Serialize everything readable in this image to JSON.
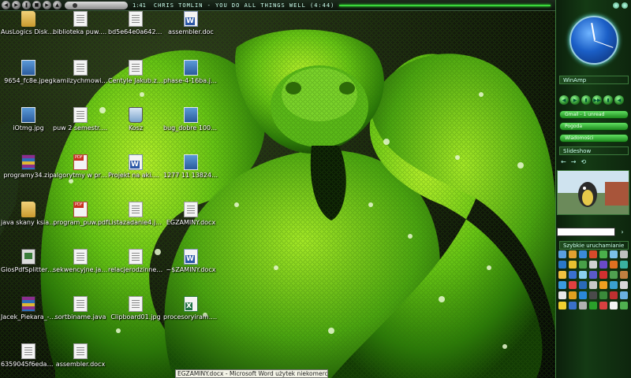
{
  "media_bar": {
    "time": "1:41",
    "track": "CHRIS TOMLIN - YOU DO ALL THINGS WELL (4:44)",
    "buttons": [
      "prev-icon",
      "play-icon",
      "pause-icon",
      "stop-icon",
      "next-icon",
      "eject-icon"
    ]
  },
  "desktop_icons": [
    {
      "label": "AusLogics Disk Defrag",
      "type": "folder"
    },
    {
      "label": "biblioteka puw.txt",
      "type": "doc"
    },
    {
      "label": "bd5e64e0a642b6a9....",
      "type": "doc"
    },
    {
      "label": "assembler.doc",
      "type": "word"
    },
    {
      "label": "9654_fc8e.jpeg",
      "type": "img"
    },
    {
      "label": "kamilzychmowi.txt",
      "type": "doc"
    },
    {
      "label": "Centyle Jakub.zone",
      "type": "doc"
    },
    {
      "label": "phase-4-16ba.jpg",
      "type": "img"
    },
    {
      "label": "iOtmg.jpg",
      "type": "img"
    },
    {
      "label": "puw 2 semestr.txt",
      "type": "doc"
    },
    {
      "label": "Kosz",
      "type": "bin"
    },
    {
      "label": "bug_dobre 100%.jpg",
      "type": "img"
    },
    {
      "label": "programy34.zip",
      "type": "rar"
    },
    {
      "label": "algorytmy w przykładach Delphi...",
      "type": "pdf"
    },
    {
      "label": "Projekt na aki.doc",
      "type": "word"
    },
    {
      "label": "1277 11 1382424...",
      "type": "img"
    },
    {
      "label": "java skany ksiazek",
      "type": "folder"
    },
    {
      "label": "program_puw.pdf",
      "type": "pdf"
    },
    {
      "label": "Listazadanie4.java",
      "type": "doc"
    },
    {
      "label": "EGZAMINY.docx",
      "type": "doc"
    },
    {
      "label": "GiosPdfSplitterMer...",
      "type": "app"
    },
    {
      "label": "sekwencyjne.java",
      "type": "doc"
    },
    {
      "label": "relacjerodzinne.java",
      "type": "doc"
    },
    {
      "label": "~$ZAMINY.docx",
      "type": "word"
    },
    {
      "label": "Jacek_Piekara_-_w...",
      "type": "rar"
    },
    {
      "label": "sortbiname.java",
      "type": "doc"
    },
    {
      "label": "Clipboard01.jpg",
      "type": "doc"
    },
    {
      "label": "procesoryiram.xlsx",
      "type": "xls"
    },
    {
      "label": "6359045f6eda5805...",
      "type": "doc"
    },
    {
      "label": "assembler.docx",
      "type": "doc"
    }
  ],
  "sidebar": {
    "winamp_title": "WinAmp",
    "winamp_buttons": [
      "◀",
      "▶",
      "▮",
      "▶▶",
      "▮",
      "◀"
    ],
    "bars": [
      "Gmail - 1 unread",
      "Pogoda",
      "Wiadomości"
    ],
    "slideshow_title": "Slideshow",
    "slide_nav": [
      "←",
      "→",
      "⟲"
    ],
    "quick_launch_title": "Szybkie uruchamianie",
    "input_button": "›"
  },
  "quick_launch_colors": [
    "#5aa0e0",
    "#e0a030",
    "#3a8ad8",
    "#d84a2a",
    "#4ab04a",
    "#7ac0e8",
    "#c0c0c0",
    "#2a78c8",
    "#e8c030",
    "#48a048",
    "#d0d0d0",
    "#6a4ac8",
    "#e07020",
    "#3ab0a0",
    "#f0c040",
    "#3a70d0",
    "#8ad0f0",
    "#5a5ac8",
    "#d03030",
    "#50a050",
    "#c08040",
    "#3a9ae0",
    "#e04040",
    "#2a6ab8",
    "#c8c8c8",
    "#f0a020",
    "#3aa0d0",
    "#d8d8d8",
    "#e8e8e8",
    "#e0a020",
    "#2a88d8",
    "#4a4a4a",
    "#3a8a3a",
    "#c03030",
    "#6ab0e0",
    "#f0d030",
    "#3a70c8",
    "#b0b0b0",
    "#2aa02a",
    "#d84040",
    "#f4f4f4",
    "#50b050"
  ],
  "taskbar_tooltip": "EGZAMINY.docx - Microsoft Word użytek niekomercyjny"
}
